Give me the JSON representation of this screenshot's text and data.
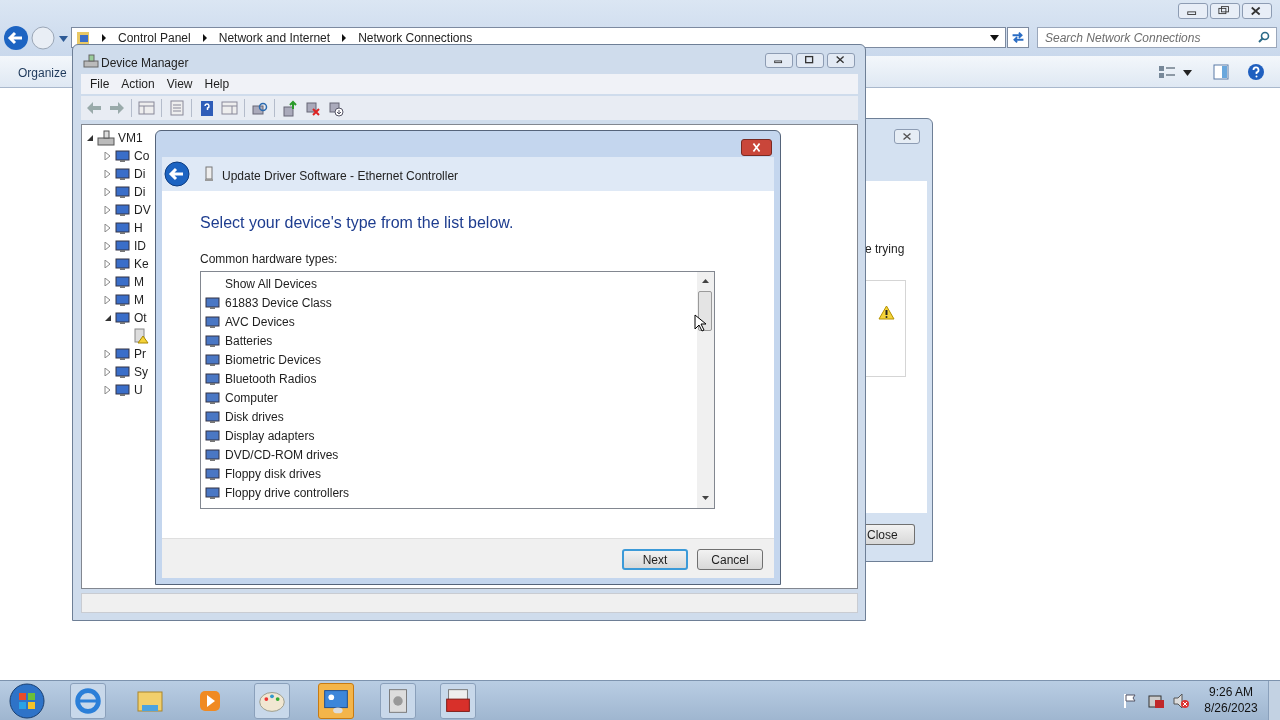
{
  "explorer": {
    "breadcrumb": [
      "Control Panel",
      "Network and Internet",
      "Network Connections"
    ],
    "search": {
      "placeholder": "Search Network Connections"
    },
    "toolbar": [
      "Organize"
    ]
  },
  "background_dialog": {
    "text": "e trying",
    "buttons": [
      "Close"
    ]
  },
  "device_manager": {
    "title": "Device Manager",
    "menu": [
      "File",
      "Action",
      "View",
      "Help"
    ],
    "tree": [
      {
        "label": "VM1",
        "expanded": true,
        "children": [
          {
            "label": "Co",
            "expanded": false
          },
          {
            "label": "Di",
            "expanded": false
          },
          {
            "label": "Di",
            "expanded": false
          },
          {
            "label": "DV",
            "expanded": false
          },
          {
            "label": "H",
            "expanded": false
          },
          {
            "label": "ID",
            "expanded": false
          },
          {
            "label": "Ke",
            "expanded": false
          },
          {
            "label": "M",
            "expanded": false
          },
          {
            "label": "M",
            "expanded": false
          },
          {
            "label": "Ot",
            "expanded": true,
            "children": [
              {
                "kind": "unknown-device"
              }
            ]
          },
          {
            "label": "Pr",
            "expanded": false
          },
          {
            "label": "Sy",
            "expanded": false
          },
          {
            "label": "U",
            "expanded": false
          }
        ]
      }
    ]
  },
  "update_dialog": {
    "title": "Update Driver Software - Ethernet Controller",
    "heading": "Select your device's type from the list below.",
    "list_label": "Common hardware types:",
    "items": [
      {
        "label": "Show All Devices",
        "has_icon": false
      },
      {
        "label": "61883 Device Class",
        "has_icon": true
      },
      {
        "label": "AVC Devices",
        "has_icon": true
      },
      {
        "label": "Batteries",
        "has_icon": true
      },
      {
        "label": "Biometric Devices",
        "has_icon": true
      },
      {
        "label": "Bluetooth Radios",
        "has_icon": true
      },
      {
        "label": "Computer",
        "has_icon": true
      },
      {
        "label": "Disk drives",
        "has_icon": true
      },
      {
        "label": "Display adapters",
        "has_icon": true
      },
      {
        "label": "DVD/CD-ROM drives",
        "has_icon": true
      },
      {
        "label": "Floppy disk drives",
        "has_icon": true
      },
      {
        "label": "Floppy drive controllers",
        "has_icon": true
      }
    ],
    "buttons": [
      "Next",
      "Cancel"
    ]
  },
  "taskbar": {
    "time": "9:26 AM",
    "date": "8/26/2023"
  }
}
